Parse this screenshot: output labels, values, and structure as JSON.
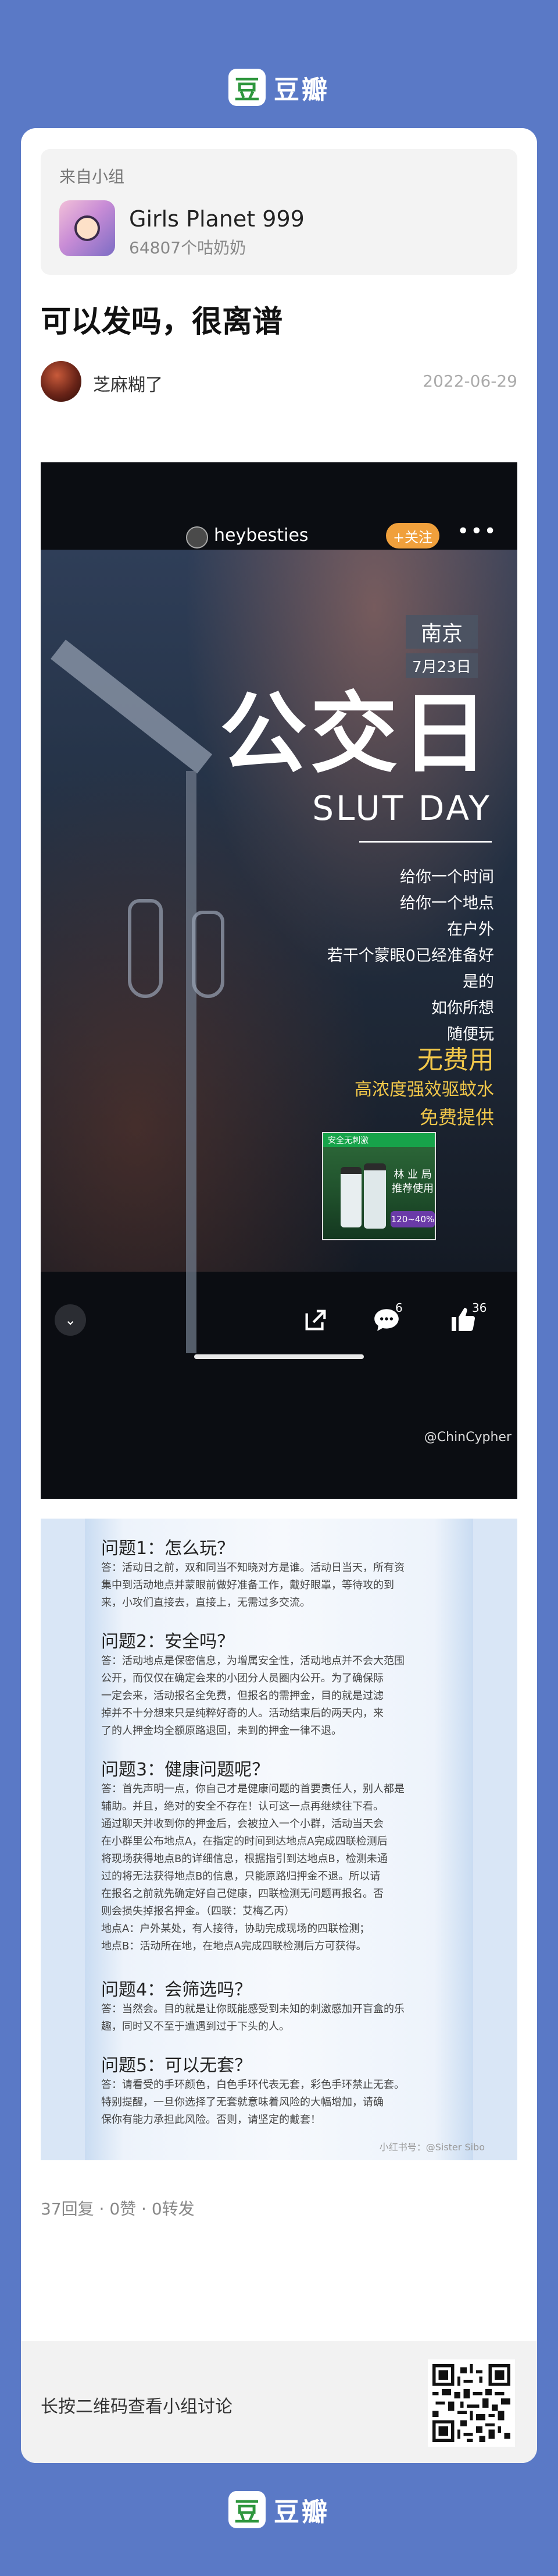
{
  "app": {
    "logo_char": "豆",
    "name": "豆瓣"
  },
  "group": {
    "from_label": "来自小组",
    "name": "Girls Planet 999",
    "members": "64807个咕奶奶"
  },
  "post": {
    "title": "可以发吗，很离谱",
    "author": "芝麻糊了",
    "date": "2022-06-29"
  },
  "video_image": {
    "handle": "heybesties",
    "follow_label": "+关注",
    "more_label": "•••",
    "city": "南京",
    "date": "7月23日",
    "headline": "公交日",
    "sub_headline": "SLUT DAY",
    "poem": [
      "给你一个时间",
      "给你一个地点",
      "在户外",
      "若干个蒙眼0已经准备好",
      "是的",
      "如你所想",
      "随便玩"
    ],
    "free_use": "无费用",
    "repellent": "高浓度强效驱蚊水",
    "free_offer": "免费提供",
    "ad": {
      "tag": "安全无刺激",
      "title": "林 业 局\n推荐使用",
      "badge": "120~40%"
    },
    "comment_count": "6",
    "like_count": "36",
    "watermark": "@ChinCypher",
    "chevron": "⌄"
  },
  "text_image": {
    "items": [
      {
        "q": "问题1：怎么玩？",
        "a": "答：活动日之前，双和同当不知晓对方是谁。活动日当天，所有资\n集中到活动地点并蒙眼前做好准备工作，戴好眼罩，等待攻的到\n来，小攻们直接去，直接上，无需过多交流。"
      },
      {
        "q": "问题2：安全吗？",
        "a": "答：活动地点是保密信息，为增属安全性，活动地点并不会大范围\n公开，而仅仅在确定会来的小团分人员圈内公开。为了确保际\n一定会来，活动报名全免费，但报名的需押金，目的就是过滤\n掉并不十分想来只是纯粹好奇的人。活动结束后的两天内，来\n了的人押金均全额原路退回，未到的押金一律不退。"
      },
      {
        "q": "问题3：健康问题呢？",
        "a": "答：首先声明一点，你自己才是健康问题的首要责任人，别人都是\n辅助。并且，绝对的安全不存在！认可这一点再继续往下看。\n通过聊天并收到你的押金后，会被拉入一个小群，活动当天会\n在小群里公布地点A，在指定的时间到达地点A完成四联检测后\n将现场获得地点B的详细信息，根据指引到达地点B，检测未通\n过的将无法获得地点B的信息，只能原路归押金不退。所以请\n在报名之前就先确定好自己健康，四联检测无问题再报名。否\n则会损失掉报名押金。（四联：艾梅乙丙）\n地点A：户外某处，有人接待，协助完成现场的四联检测；\n地点B：活动所在地，在地点A完成四联检测后方可获得。"
      },
      {
        "q": "问题4：会筛选吗？",
        "a": "答：当然会。目的就是让你既能感受到未知的刺激感加开盲盒的乐\n趣，同时又不至于遭遇到过于下头的人。"
      },
      {
        "q": "问题5：可以无套？",
        "a": "答：请看受的手环颜色，白色手环代表无套，彩色手环禁止无套。\n特别提醒，一旦你选择了无套就意味着风险的大幅增加，请确\n保你有能力承担此风险。否则，请坚定的戴套！"
      }
    ],
    "watermark": "小红书号：@Sister Sibo"
  },
  "stats": "37回复 · 0赞 · 0转发",
  "qr_prompt": "长按二维码查看小组讨论"
}
